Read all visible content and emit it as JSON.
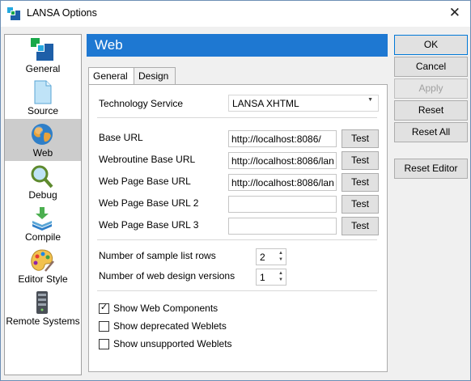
{
  "window": {
    "title": "LANSA Options",
    "close_glyph": "✕"
  },
  "sidebar": {
    "items": [
      {
        "label": "General",
        "icon": "general-icon"
      },
      {
        "label": "Source",
        "icon": "source-icon"
      },
      {
        "label": "Web",
        "icon": "globe-icon",
        "selected": true
      },
      {
        "label": "Debug",
        "icon": "magnifier-icon"
      },
      {
        "label": "Compile",
        "icon": "compile-icon"
      },
      {
        "label": "Editor Style",
        "icon": "palette-icon"
      },
      {
        "label": "Remote Systems",
        "icon": "server-icon"
      }
    ]
  },
  "panel": {
    "title": "Web",
    "tabs": [
      {
        "label": "General",
        "active": true
      },
      {
        "label": "Design"
      }
    ]
  },
  "general": {
    "technology_service": {
      "label": "Technology Service",
      "value": "LANSA XHTML"
    },
    "urls": [
      {
        "label": "Base URL",
        "value": "http://localhost:8086/",
        "button": "Test"
      },
      {
        "label": "Webroutine Base URL",
        "value": "http://localhost:8086/lan",
        "button": "Test"
      },
      {
        "label": "Web Page Base URL",
        "value": "http://localhost:8086/lan",
        "button": "Test"
      },
      {
        "label": "Web Page Base URL 2",
        "value": "",
        "button": "Test"
      },
      {
        "label": "Web Page Base URL 3",
        "value": "",
        "button": "Test"
      }
    ],
    "sample_rows": {
      "label": "Number of sample list rows",
      "value": "2"
    },
    "design_versions": {
      "label": "Number of web design versions",
      "value": "1"
    },
    "checkboxes": [
      {
        "label": "Show Web Components",
        "checked": true
      },
      {
        "label": "Show deprecated Weblets",
        "checked": false
      },
      {
        "label": "Show unsupported Weblets",
        "checked": false
      }
    ],
    "check_glyph": "✓"
  },
  "buttons": {
    "ok": "OK",
    "cancel": "Cancel",
    "apply": "Apply",
    "reset": "Reset",
    "reset_all": "Reset All",
    "reset_editor": "Reset Editor"
  },
  "colors": {
    "header": "#1e78d2",
    "selected": "#cccccc"
  }
}
